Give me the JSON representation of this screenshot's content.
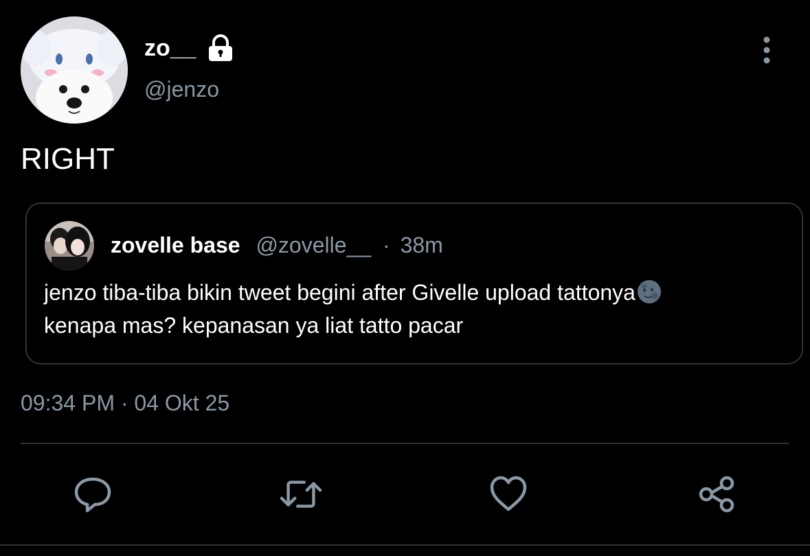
{
  "author": {
    "display_name": "zo__",
    "handle": "@jenzo",
    "avatar_icon": "dog-in-bunny-hat-avatar",
    "protected_icon": "lock-icon"
  },
  "tweet": {
    "text": "RIGHT",
    "timestamp": "09:34 PM · 04 Okt 25"
  },
  "quoted_tweet": {
    "display_name": "zovelle base",
    "handle": "@zovelle__",
    "separator": "·",
    "age": "38m",
    "line1": "jenzo tiba-tiba bikin tweet begini after Givelle upload tattonya",
    "line1_emoji": "new-moon-face-emoji",
    "line2": "kenapa mas? kepanasan ya liat tatto pacar"
  },
  "actions": {
    "reply": "comment-icon",
    "retweet": "retweet-icon",
    "like": "heart-icon",
    "share": "share-icon"
  },
  "colors": {
    "background": "#000000",
    "text": "#ffffff",
    "secondary_text": "#8b98a5",
    "border": "#2f3336",
    "icon": "#8b98a5"
  }
}
